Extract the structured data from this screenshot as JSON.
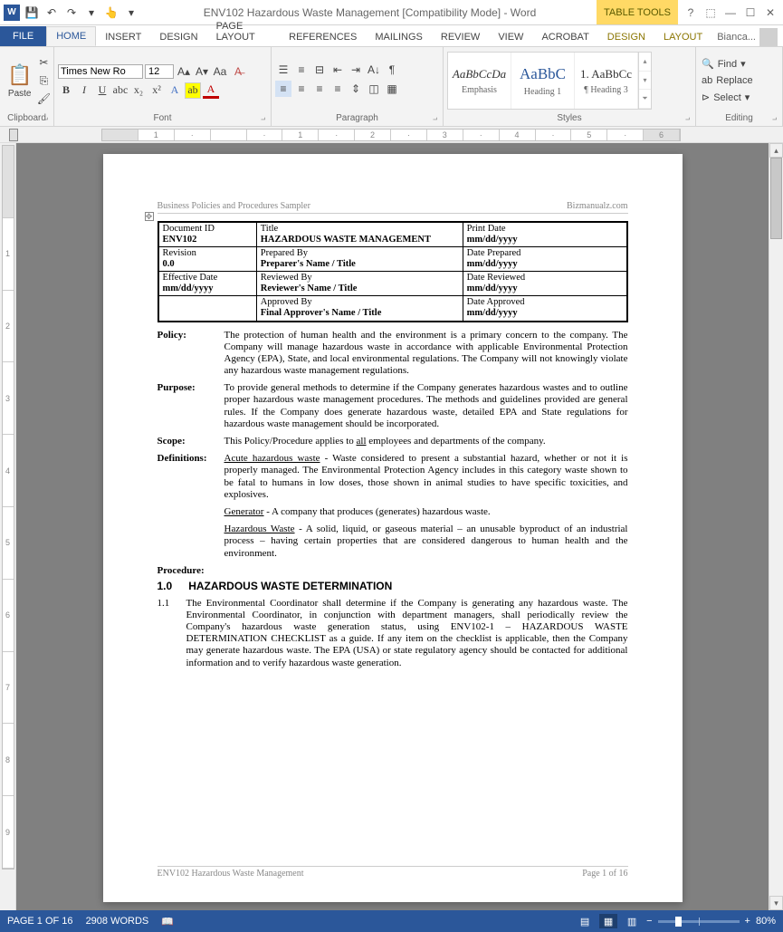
{
  "titlebar": {
    "app_icon": "W",
    "title": "ENV102 Hazardous Waste Management [Compatibility Mode] - Word",
    "table_tools": "TABLE TOOLS",
    "help": "?",
    "user": "Bianca..."
  },
  "tabs": {
    "file": "FILE",
    "home": "HOME",
    "insert": "INSERT",
    "design": "DESIGN",
    "page_layout": "PAGE LAYOUT",
    "references": "REFERENCES",
    "mailings": "MAILINGS",
    "review": "REVIEW",
    "view": "VIEW",
    "acrobat": "ACROBAT",
    "tt_design": "DESIGN",
    "tt_layout": "LAYOUT"
  },
  "ribbon": {
    "clipboard": {
      "label": "Clipboard",
      "paste": "Paste"
    },
    "font": {
      "label": "Font",
      "name": "Times New Ro",
      "size": "12"
    },
    "paragraph": {
      "label": "Paragraph"
    },
    "styles": {
      "label": "Styles",
      "items": [
        {
          "preview": "AaBbCcDa",
          "name": "Emphasis"
        },
        {
          "preview": "AaBbC",
          "name": "Heading 1"
        },
        {
          "preview": "1. AaBbCc",
          "name": "¶ Heading 3"
        }
      ]
    },
    "editing": {
      "label": "Editing",
      "find": "Find",
      "replace": "Replace",
      "select": "Select"
    }
  },
  "document": {
    "header_left": "Business Policies and Procedures Sampler",
    "header_right": "Bizmanualz.com",
    "table": {
      "r1c1l": "Document ID",
      "r1c1v": "ENV102",
      "r1c2l": "Title",
      "r1c2v": "HAZARDOUS WASTE MANAGEMENT",
      "r1c3l": "Print Date",
      "r1c3v": "mm/dd/yyyy",
      "r2c1l": "Revision",
      "r2c1v": "0.0",
      "r2c2l": "Prepared By",
      "r2c2v": "Preparer's Name / Title",
      "r2c3l": "Date Prepared",
      "r2c3v": "mm/dd/yyyy",
      "r3c1l": "Effective Date",
      "r3c1v": "mm/dd/yyyy",
      "r3c2l": "Reviewed By",
      "r3c2v": "Reviewer's Name / Title",
      "r3c3l": "Date Reviewed",
      "r3c3v": "mm/dd/yyyy",
      "r4c2l": "Approved By",
      "r4c2v": "Final Approver's Name / Title",
      "r4c3l": "Date Approved",
      "r4c3v": "mm/dd/yyyy"
    },
    "policy_label": "Policy:",
    "policy_body": "The protection of human health and the environment is a primary concern to the company.  The Company will manage hazardous waste in accordance with applicable Environmental Protection Agency (EPA), State, and local environmental regulations.  The Company will not knowingly violate any hazardous waste management regulations.",
    "purpose_label": "Purpose:",
    "purpose_body": "To provide general methods to determine if the Company generates hazardous wastes and to outline proper hazardous waste management procedures.  The methods and guidelines provided are general rules.  If the Company does generate hazardous waste, detailed EPA and State regulations for hazardous waste management should be incorporated.",
    "scope_label": "Scope:",
    "scope_pre": "This Policy/Procedure applies to ",
    "scope_u": "all",
    "scope_post": " employees and departments of the company.",
    "defs_label": "Definitions:",
    "def1_u": "Acute hazardous waste",
    "def1_body": " - Waste considered to present a substantial hazard, whether or not it is properly managed.  The Environmental Protection Agency includes in this category waste shown to be fatal to humans in low doses, those shown in animal studies to have specific toxicities, and explosives.",
    "def2_u": "Generator",
    "def2_body": " - A company that produces (generates) hazardous waste.",
    "def3_u": "Hazardous Waste",
    "def3_body": " - A solid, liquid, or gaseous material – an unusable byproduct of an industrial process – having certain properties that are considered dangerous to human health and the environment.",
    "procedure_label": "Procedure:",
    "sec_num": "1.0",
    "sec_title": "HAZARDOUS WASTE DETERMINATION",
    "para_num": "1.1",
    "para_body": "The Environmental Coordinator shall determine if the Company is generating any hazardous waste.  The Environmental Coordinator, in conjunction with department managers, shall periodically review the Company's hazardous waste generation status, using ENV102-1 – HAZARDOUS WASTE DETERMINATION CHECKLIST as a guide.  If any item on the checklist is applicable, then the Company may generate hazardous waste.  The EPA (USA) or state regulatory agency should be contacted for additional information and to verify hazardous waste generation.",
    "footer_left": "ENV102 Hazardous Waste Management",
    "footer_right": "Page 1 of 16"
  },
  "statusbar": {
    "page": "PAGE 1 OF 16",
    "words": "2908 WORDS",
    "zoom": "80%"
  }
}
